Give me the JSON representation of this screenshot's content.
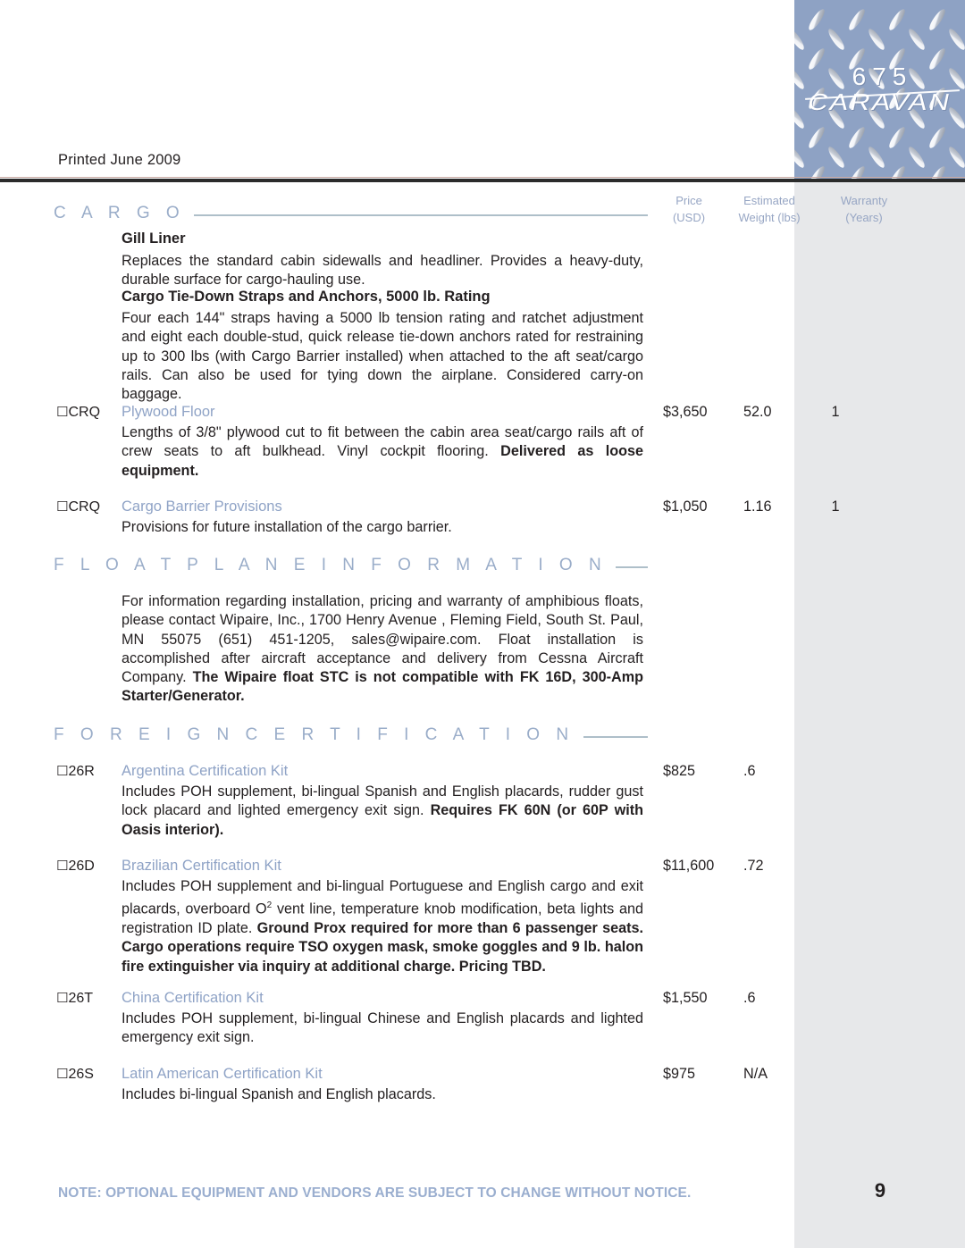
{
  "header": {
    "brand_model": "675",
    "brand_name": "CARAVAN",
    "printed": "Printed June 2009"
  },
  "columns": {
    "price": "Price\n(USD)",
    "price_l1": "Price",
    "price_l2": "(USD)",
    "weight_l1": "Estimated",
    "weight_l2": "Weight (lbs)",
    "warranty_l1": "Warranty",
    "warranty_l2": "(Years)"
  },
  "sections": [
    {
      "title": "C A R G O"
    },
    {
      "title": "F L O A T P L A N E   I N F O R M A T I O N"
    },
    {
      "title": "F O R E I G N   C E R T I F I C A T I O N"
    }
  ],
  "cargo": {
    "gill_liner": {
      "title": "Gill Liner",
      "desc": "Replaces the standard cabin sidewalls and headliner. Provides a heavy-duty, durable surface for cargo-hauling use."
    },
    "tie_down": {
      "title": "Cargo Tie-Down Straps and Anchors, 5000 lb. Rating",
      "desc": "Four each 144\" straps having a 5000 lb tension rating and ratchet adjustment and eight each double-stud, quick release tie-down anchors rated for restraining up to 300 lbs (with Cargo Barrier installed) when attached to the aft seat/cargo rails. Can also be used for tying down the airplane. Considered carry-on baggage."
    },
    "plywood_floor": {
      "code": "CRQ",
      "title": "Plywood Floor",
      "desc_normal": "Lengths of 3/8\" plywood cut to fit between the cabin area seat/cargo rails aft of crew seats to aft bulkhead. Vinyl cockpit flooring. ",
      "desc_bold": "Delivered as loose equipment.",
      "price": "$3,650",
      "weight": "52.0",
      "warranty": "1"
    },
    "cargo_barrier": {
      "code": "CRQ",
      "title": "Cargo Barrier Provisions",
      "desc": "Provisions for future installation of the cargo barrier.",
      "price": "$1,050",
      "weight": "1.16",
      "warranty": "1"
    }
  },
  "floatplane": {
    "desc_normal": "For information regarding installation, pricing and warranty of amphibious floats, please contact Wipaire, Inc., 1700 Henry Avenue , Fleming Field, South St. Paul, MN 55075 (651) 451-1205, sales@wipaire.com. Float installation is accomplished after aircraft acceptance and delivery from Cessna Aircraft Company. ",
    "desc_bold": "The Wipaire float STC is not compatible with FK 16D,  300-Amp Starter/Generator."
  },
  "foreign": [
    {
      "code": "26R",
      "title": "Argentina Certification Kit",
      "desc_normal": "Includes POH supplement, bi-lingual Spanish and English placards, rudder gust lock placard and lighted emergency exit sign. ",
      "desc_bold": "Requires FK 60N (or 60P with Oasis interior).",
      "price": "$825",
      "weight": ".6",
      "warranty": ""
    },
    {
      "code": "26D",
      "title": "Brazilian Certification Kit",
      "desc_normal_a": "Includes POH supplement and bi-lingual Portuguese and English cargo and exit placards, overboard O",
      "desc_sup": "2",
      "desc_normal_b": " vent line, temperature knob modification, beta lights and registration ID plate. ",
      "desc_bold": "Ground Prox required for more than 6 passenger seats. Cargo operations require TSO oxygen mask, smoke goggles and 9 lb. halon fire extinguisher via inquiry at additional charge. Pricing TBD.",
      "price": "$11,600",
      "weight": ".72",
      "warranty": ""
    },
    {
      "code": "26T",
      "title": "China Certification Kit",
      "desc_normal": "Includes POH supplement, bi-lingual Chinese and English placards and lighted emergency exit sign.",
      "price": "$1,550",
      "weight": ".6",
      "warranty": ""
    },
    {
      "code": "26S",
      "title": "Latin American Certification Kit",
      "desc_normal": "Includes bi-lingual Spanish and English placards.",
      "price": "$975",
      "weight": "N/A",
      "warranty": ""
    }
  ],
  "footer": {
    "note": "NOTE:  OPTIONAL EQUIPMENT AND VENDORS ARE SUBJECT TO CHANGE WITHOUT NOTICE.",
    "page": "9"
  },
  "colors": {
    "accent_blue": "#8fa3c6",
    "header_band": "#8ea2c4",
    "grey_column": "#e7e8ea",
    "rule_dark": "#2b2b2b"
  }
}
